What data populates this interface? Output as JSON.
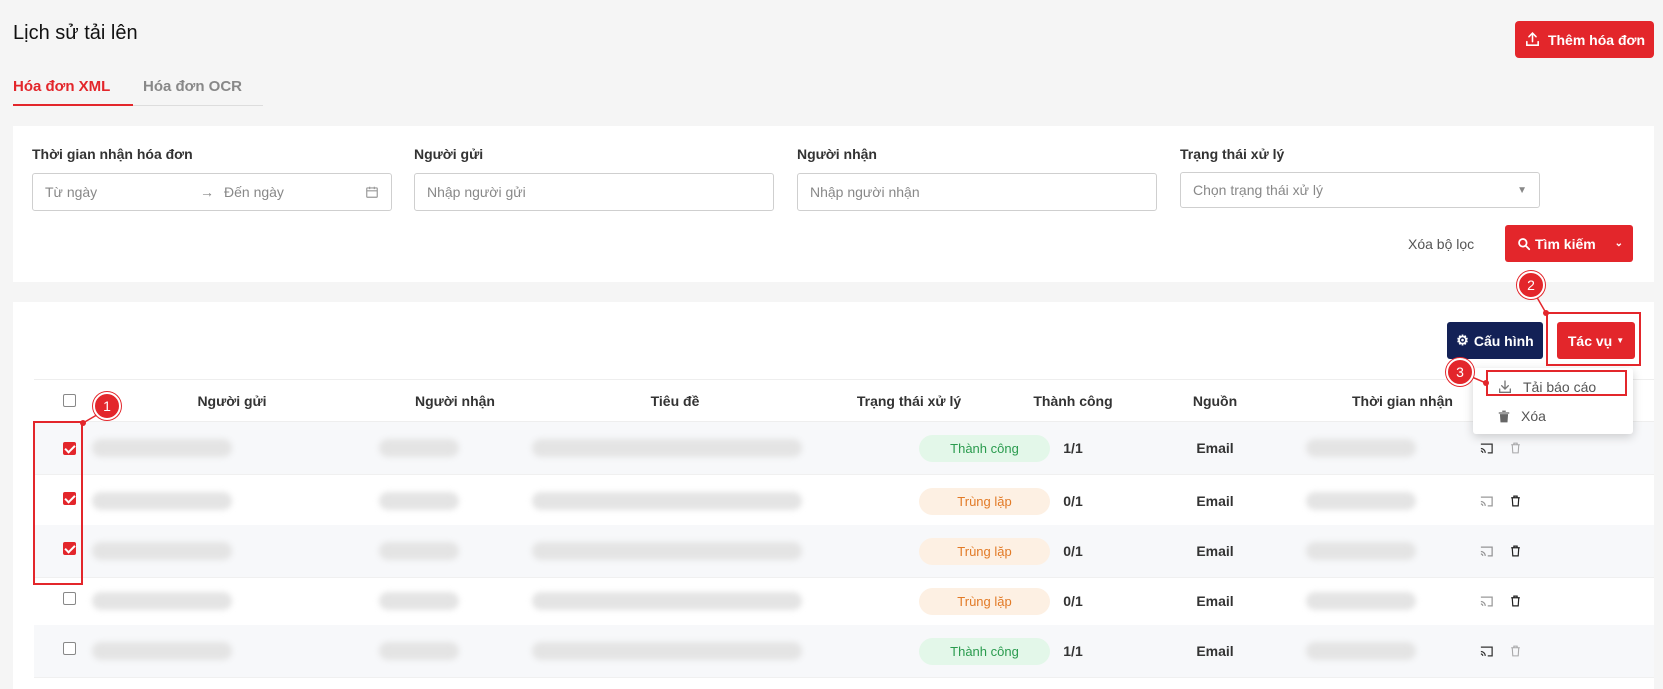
{
  "page": {
    "title": "Lịch sử tải lên",
    "add_button": "Thêm hóa đơn"
  },
  "tabs": [
    {
      "label": "Hóa đơn XML",
      "active": true
    },
    {
      "label": "Hóa đơn OCR",
      "active": false
    }
  ],
  "filters": {
    "time": {
      "label": "Thời gian nhận hóa đơn",
      "from_placeholder": "Từ ngày",
      "to_placeholder": "Đến ngày"
    },
    "sender": {
      "label": "Người gửi",
      "placeholder": "Nhập người gửi"
    },
    "receiver": {
      "label": "Người nhận",
      "placeholder": "Nhập người nhận"
    },
    "status": {
      "label": "Trạng thái xử lý",
      "placeholder": "Chọn trạng thái xử lý"
    },
    "clear_label": "Xóa bộ lọc",
    "search_label": "Tìm kiếm"
  },
  "toolbar": {
    "config_label": "Cấu hình",
    "tasks_label": "Tác vụ"
  },
  "dropdown": {
    "items": [
      {
        "label": "Tải báo cáo",
        "icon": "download-icon"
      },
      {
        "label": "Xóa",
        "icon": "trash-icon"
      }
    ]
  },
  "table": {
    "columns": [
      "Người gửi",
      "Người nhận",
      "Tiêu đề",
      "Trạng thái xử lý",
      "Thành công",
      "Nguồn",
      "Thời gian nhận"
    ],
    "rows": [
      {
        "checked": true,
        "status": "Thành công",
        "status_type": "ok",
        "success": "1/1",
        "source": "Email"
      },
      {
        "checked": true,
        "status": "Trùng lặp",
        "status_type": "dup",
        "success": "0/1",
        "source": "Email"
      },
      {
        "checked": true,
        "status": "Trùng lặp",
        "status_type": "dup",
        "success": "0/1",
        "source": "Email"
      },
      {
        "checked": false,
        "status": "Trùng lặp",
        "status_type": "dup",
        "success": "0/1",
        "source": "Email"
      },
      {
        "checked": false,
        "status": "Thành công",
        "status_type": "ok",
        "success": "1/1",
        "source": "Email"
      }
    ]
  },
  "annotations": [
    "1",
    "2",
    "3"
  ],
  "colors": {
    "accent": "#e3262b",
    "navy": "#132156",
    "success_bg": "#e3f7e9",
    "duplicate_bg": "#fdf0e3"
  }
}
